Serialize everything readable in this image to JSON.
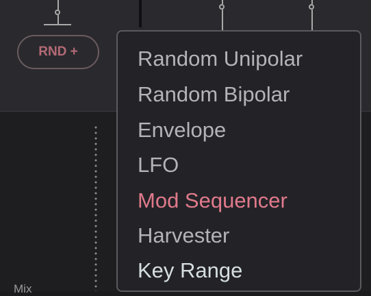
{
  "module": {
    "button_label": "RND +",
    "mix_label": "Mix"
  },
  "menu": {
    "items": [
      {
        "label": "Random Unipolar",
        "state": "normal"
      },
      {
        "label": "Random Bipolar",
        "state": "normal"
      },
      {
        "label": "Envelope",
        "state": "normal"
      },
      {
        "label": "LFO",
        "state": "normal"
      },
      {
        "label": "Mod Sequencer",
        "state": "highlighted"
      },
      {
        "label": "Harvester",
        "state": "normal"
      },
      {
        "label": "Key Range",
        "state": "hover"
      }
    ]
  },
  "colors": {
    "highlight": "#e07a8c",
    "button_text": "#b56a76",
    "menu_text": "#b3b3b8"
  }
}
